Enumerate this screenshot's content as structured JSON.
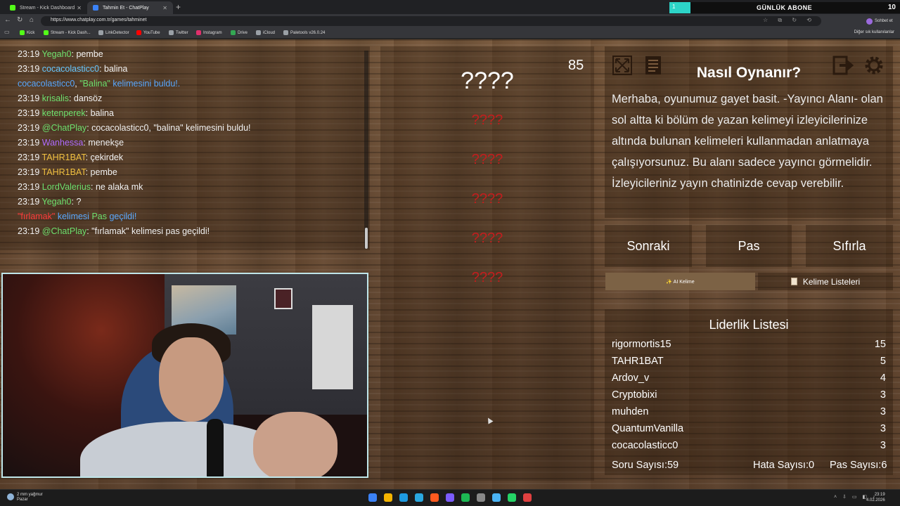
{
  "browser": {
    "tabs": [
      {
        "label": "Stream - Kick Dashboard",
        "color": "#53fc18"
      },
      {
        "label": "Tahmin Et - ChatPlay",
        "color": "#3b82f6"
      }
    ],
    "url": "https://www.chatplay.com.tr/games/tahminet",
    "bookmarks": [
      {
        "label": "Kick",
        "color": "#53fc18"
      },
      {
        "label": "Stream - Kick Dash...",
        "color": "#53fc18"
      },
      {
        "label": "LinkDetector",
        "color": "#9aa0a6"
      },
      {
        "label": "YouTube",
        "color": "#ff0000"
      },
      {
        "label": "Twitter",
        "color": "#9aa0a6"
      },
      {
        "label": "Instagram",
        "color": "#e1306c"
      },
      {
        "label": "Drive",
        "color": "#34a853"
      },
      {
        "label": "iCloud",
        "color": "#9aa0a6"
      },
      {
        "label": "Paletools v26.0.24",
        "color": "#9aa0a6"
      }
    ],
    "other_bookmarks": "Diğer sık kullanılanlar",
    "profile_label": "Sohbet et"
  },
  "subscriber_banner": {
    "label": "GÜNLÜK ABONE",
    "bar_value": "1",
    "count": "10",
    "accent": "#2dd4c8"
  },
  "chat": [
    {
      "time": "23:19",
      "user": "Yegah0",
      "sep": ": ",
      "msg": "pembe",
      "user_color": "#6ee06e"
    },
    {
      "time": "23:19",
      "user": "cocacolasticc0",
      "sep": ": ",
      "msg": "balina",
      "user_color": "#66c7ff"
    },
    {
      "time": "",
      "user": "cocacolasticc0",
      "sep": ", ",
      "highlight": "\"Balina\"",
      "msg": " kelimesini buldu!.",
      "user_color": "#5aa9ff",
      "highlight_color": "#6ee06e",
      "msg_color": "#5aa9ff"
    },
    {
      "time": "23:19",
      "user": "krisalis",
      "sep": ": ",
      "msg": "dansöz",
      "user_color": "#6ee06e"
    },
    {
      "time": "23:19",
      "user": "ketenperek",
      "sep": ": ",
      "msg": "balina",
      "user_color": "#6ee06e"
    },
    {
      "time": "23:19",
      "user": "@ChatPlay",
      "sep": ": ",
      "msg": "cocacolasticc0, \"balina\" kelimesini buldu!",
      "user_color": "#6ee06e"
    },
    {
      "time": "23:19",
      "user": "Wanhessa",
      "sep": ": ",
      "msg": "menekşe",
      "user_color": "#b06cff"
    },
    {
      "time": "23:19",
      "user": "TAHR1BAT",
      "sep": ": ",
      "msg": "çekirdek",
      "user_color": "#f0c040"
    },
    {
      "time": "23:19",
      "user": "TAHR1BAT",
      "sep": ": ",
      "msg": "pembe",
      "user_color": "#f0c040"
    },
    {
      "time": "23:19",
      "user": "LordValerius",
      "sep": ": ",
      "msg": "ne alaka mk",
      "user_color": "#6ee06e"
    },
    {
      "time": "23:19",
      "user": "Yegah0",
      "sep": ": ",
      "msg": "?",
      "user_color": "#6ee06e"
    },
    {
      "time": "",
      "user": "\"fırlamak\"",
      "sep": " ",
      "highlight": "kelimesi",
      "msg": " Pas",
      "extra": " geçildi!",
      "user_color": "#ff3b3b",
      "highlight_color": "#5aa9ff",
      "msg_color": "#6ee06e",
      "extra_color": "#5aa9ff"
    },
    {
      "time": "23:19",
      "user": "@ChatPlay",
      "sep": ": ",
      "msg": "\"fırlamak\" kelimesi pas geçildi!",
      "user_color": "#6ee06e"
    }
  ],
  "game": {
    "main_word": "????",
    "counter": "85",
    "taboo_words": [
      "????",
      "????",
      "????",
      "????",
      "????"
    ],
    "taboo_color": "#c21e1e"
  },
  "help": {
    "title": "Nasıl Oynanır?",
    "text": "Merhaba, oyunumuz gayet basit. -Yayıncı Alanı- olan sol altta ki bölüm de yazan kelimeyi izleyicilerinize altında bulunan kelimeleri kullanmadan anlatmaya çalışıyorsunuz. Bu alanı sadece yayıncı görmelidir. İzleyicileriniz yayın chatinizde cevap verebilir.",
    "icons": [
      "fullscreen-icon",
      "list-icon",
      "logout-icon",
      "gear-icon"
    ]
  },
  "actions": {
    "next": "Sonraki",
    "pass": "Pas",
    "reset": "Sıfırla",
    "ai_word": "✨ AI Kelime",
    "word_lists": "Kelime Listeleri"
  },
  "leaderboard": {
    "title": "Liderlik Listesi",
    "rows": [
      {
        "name": "rigormortis15",
        "score": "15"
      },
      {
        "name": "TAHR1BAT",
        "score": "5"
      },
      {
        "name": "Ardov_v",
        "score": "4"
      },
      {
        "name": "Cryptobixi",
        "score": "3"
      },
      {
        "name": "muhden",
        "score": "3"
      },
      {
        "name": "QuantumVanilla",
        "score": "3"
      },
      {
        "name": "cocacolasticc0",
        "score": "3"
      }
    ],
    "stats": {
      "questions": "Soru Sayısı:59",
      "errors": "Hata Sayısı:0",
      "passes": "Pas Sayısı:6"
    }
  },
  "taskbar": {
    "weather_line1": "2 mm yağmur",
    "weather_line2": "Pazar",
    "time": "23:19",
    "date": "4.02.2026",
    "app_colors": [
      "#3b82f6",
      "#f5b400",
      "#1e9ae0",
      "#2aa8e0",
      "#ff5a1f",
      "#7b5cff",
      "#1db954",
      "#888888",
      "#4ab3f4",
      "#25d366",
      "#e04040"
    ]
  }
}
